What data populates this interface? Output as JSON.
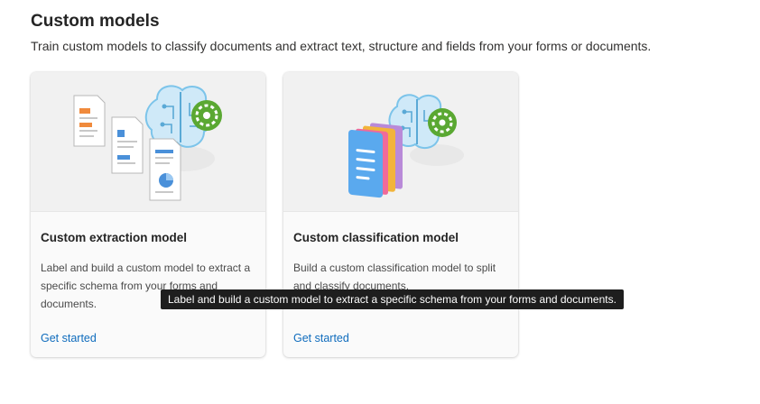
{
  "header": {
    "title": "Custom models",
    "subtitle": "Train custom models to classify documents and extract text, structure and fields from your forms or documents."
  },
  "cards": [
    {
      "title": "Custom extraction model",
      "description": "Label and build a custom model to extract a specific schema from your forms and documents.",
      "link": "Get started"
    },
    {
      "title": "Custom classification model",
      "description": "Build a custom classification model to split and classify documents.",
      "link": "Get started"
    }
  ],
  "tooltip": {
    "text": "Label and build a custom model to extract a specific schema from your forms and documents."
  },
  "colors": {
    "link": "#0f6cbd",
    "tooltip_bg": "#1e1e1e",
    "gear_green": "#5aa832"
  }
}
